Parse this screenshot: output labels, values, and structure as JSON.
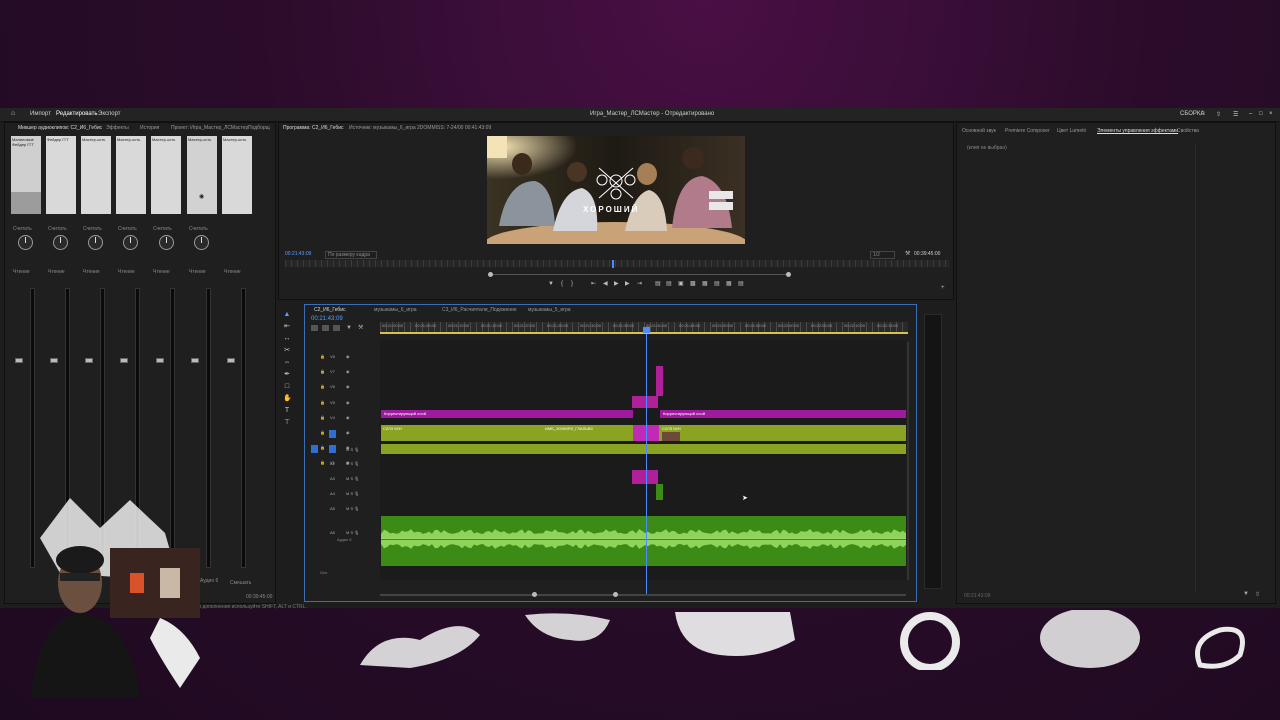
{
  "menu": {
    "items": [
      "Импорт",
      "Редактировать",
      "Экспорт"
    ],
    "window_title": "Игра_Мастер_ЛСМастер - Отредактировано",
    "right_label": "СБОРКА"
  },
  "mixer": {
    "tabs": [
      "Микшер аудиоклипов: С2_И6_Гебис",
      "Эффекты",
      "История",
      "Проект: Игра_Мастер_ЛСМастер",
      "Подборщ"
    ],
    "strips": [
      {
        "name": "Малиновые",
        "sub": "Фейдер ГГГ"
      },
      {
        "name": "Фейдер ГГГ",
        "sub": ""
      },
      {
        "name": "Мастер-ость",
        "sub": ""
      },
      {
        "name": "Мастер-ость",
        "sub": ""
      },
      {
        "name": "Мастер-ость",
        "sub": ""
      },
      {
        "name": "Мастер-ость",
        "sub": ""
      },
      {
        "name": "Мастер-ость",
        "sub": ""
      }
    ],
    "mode_label": "Считать",
    "status": "Чтение",
    "bottom_labels": [
      "Аудио 6",
      "Смешать"
    ],
    "timecode": "00:39:45:00"
  },
  "program": {
    "tabs": [
      "Программа: С2_И6_Гебис",
      "Источник: музыкамы_6_игра 2DOMMISS: 7-24/00 00:41:43:09"
    ],
    "overlay_title": "ХОРОШИЙ",
    "timecode_left": "00:21:43:09",
    "fit": "По размеру кадра",
    "resolution": "1/2",
    "timecode_right": "00:39:45:00"
  },
  "timeline": {
    "tabs": [
      "С2_И6_Гебис",
      "музыкамы_6_игра",
      "С3_И6_Расчиятали_Подожение",
      "музыкамы_5_игра"
    ],
    "timecode": "00:21:43:09",
    "ruler_ticks": [
      "00:21:00:00",
      "00:21:05:00",
      "00:21:10:00",
      "00:21:15:00",
      "00:21:20:00",
      "00:21:25:00",
      "00:21:30:00",
      "00:21:35:00",
      "00:21:40:00",
      "00:21:45:00",
      "00:21:50:00",
      "00:21:55:00",
      "00:22:00:00",
      "00:22:05:00",
      "00:22:10:00",
      "00:22:15:00"
    ],
    "video_tracks": [
      "V8",
      "V7",
      "V6",
      "V5",
      "V4",
      "V3",
      "V2",
      "V1"
    ],
    "audio_tracks": [
      "A1",
      "A2",
      "A3",
      "A4",
      "A5",
      "A6"
    ],
    "adjustment_label": "Корректирующий слой",
    "clip_labels": [
      "С2ЛЗ М/Н",
      "ИМБ_ЗОНМЯЗ_ГЛАЛЬВЗ",
      "С2ЛЗ М/Н"
    ],
    "master_label": "Осн.",
    "audio6_label": "Аудио 6",
    "hint": "Для дополнения используйте SHIFT, ALT и CTRL."
  },
  "right_panel": {
    "tabs": [
      "Основной звук",
      "Premiere Composer",
      "Цвет Lumetri",
      "Элементы управления эффектами",
      "Свойства"
    ],
    "no_clip": "(клип не выбран)",
    "timecode": "00:21:43:09"
  },
  "colors": {
    "video_clip": "#8aa322",
    "adjustment": "#a01aa0",
    "audio": "#3c8b16",
    "waveform": "#8ed45a",
    "playhead": "#4a8cff"
  }
}
